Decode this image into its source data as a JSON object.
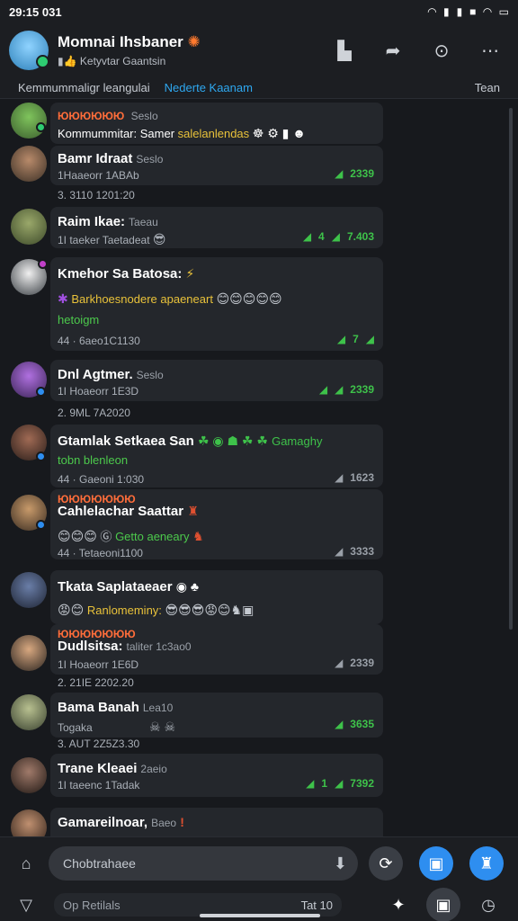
{
  "status": {
    "time": "29:15 031",
    "icons": [
      "wifi-icon",
      "signal-icon",
      "signal-icon",
      "battery-icon",
      "wifi-icon",
      "battery-icon"
    ]
  },
  "header": {
    "title": "Momnai Ihsbaner",
    "subtitle": "Ketyvtar Gaantsin"
  },
  "tabs": {
    "left": "Kemmummaligr leangulai",
    "active": "Nederte Kaanam",
    "right": "Tean"
  },
  "chats": [
    {
      "line1": "ЮЮЮЮЮЮ",
      "line1b": "Seslo",
      "line2": "Kommummitar: Samer",
      "line2b": "salelanlendas"
    },
    {
      "name": "Bamr Idraat",
      "time": "Seslo",
      "meta": "1Haaeorr 1ABAb",
      "stat": "2339",
      "date": "3. 3110 1201:20"
    },
    {
      "name": "Raim Ikae:",
      "time": "Taeau",
      "meta": "1I taeker Taetadeat",
      "stats": [
        "4",
        "7.403"
      ]
    },
    {
      "name": "Kmehor Sa Batosa:",
      "line2": "Barkhoesnodere",
      "line2b": "apaeneart",
      "line3": "hetoigm",
      "meta": "44 · 6aeo1C1130",
      "stat": "7"
    },
    {
      "name": "Dnl Agtmer.",
      "time": "Seslo",
      "meta": "1I Hoaeorr 1E3D",
      "stat": "2339",
      "date": "2. 9ML 7A2020"
    },
    {
      "name": "Gtamlak Setkaea San",
      "extra": "Gamaghy",
      "line2": "tobn blenleon",
      "meta": "44 · Gaeoni 1:030",
      "stat": "1623"
    },
    {
      "name": "Cahlelachar Saattar",
      "line0": "ЮЮЮЮЮЮЮ",
      "line2": "Getto aeneary",
      "meta": "44 · Tetaeoni1100",
      "stat": "3333"
    },
    {
      "name": "Tkata Saplataeaer",
      "line2": "Ranlomeminy:"
    },
    {
      "name": "Dudlsitsa:",
      "time": "taliter 1c3ao0",
      "line0": "ЮЮЮЮЮЮЮ",
      "meta": "1I Hoaeorr 1E6D",
      "stat": "2339",
      "date": "2. 21IE 2202.20"
    },
    {
      "name": "Bama Banah",
      "time": "Lea10",
      "meta": "Togaka",
      "stat": "3635",
      "date": "3. AUT 2Z5Z3.30"
    },
    {
      "name": "Trane Kleaei",
      "time": "2aeio",
      "meta": "1I taeenc 1Tadak",
      "stats": [
        "1",
        "7392"
      ]
    },
    {
      "name": "Gamareilnoar,",
      "time": "Baeo"
    }
  ],
  "composer": {
    "placeholder": "Chobtrahaee",
    "secondary": "Op Retilals",
    "secondary_right": "Tat 10"
  }
}
